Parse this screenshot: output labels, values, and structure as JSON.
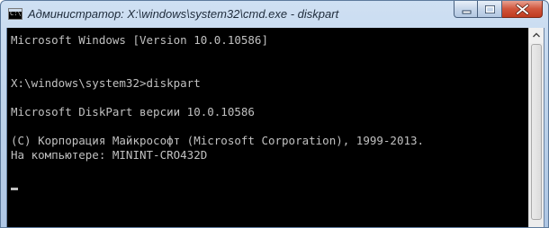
{
  "window": {
    "title": "Администратор: X:\\windows\\system32\\cmd.exe - diskpart",
    "icon": "cmd-icon",
    "icon_text": "C:\\"
  },
  "controls": {
    "minimize": "minimize-icon",
    "maximize": "maximize-icon",
    "close": "close-icon"
  },
  "console": {
    "lines": [
      "Microsoft Windows [Version 10.0.10586]",
      "",
      "",
      "X:\\windows\\system32>diskpart",
      "",
      "Microsoft DiskPart версии 10.0.10586",
      "",
      "(C) Корпорация Майкрософт (Microsoft Corporation), 1999-2013.",
      "На компьютере: MININT-CRO432D",
      ""
    ]
  },
  "colors": {
    "console_bg": "#000000",
    "console_text": "#c0c0c0",
    "close_button": "#c8452a"
  }
}
